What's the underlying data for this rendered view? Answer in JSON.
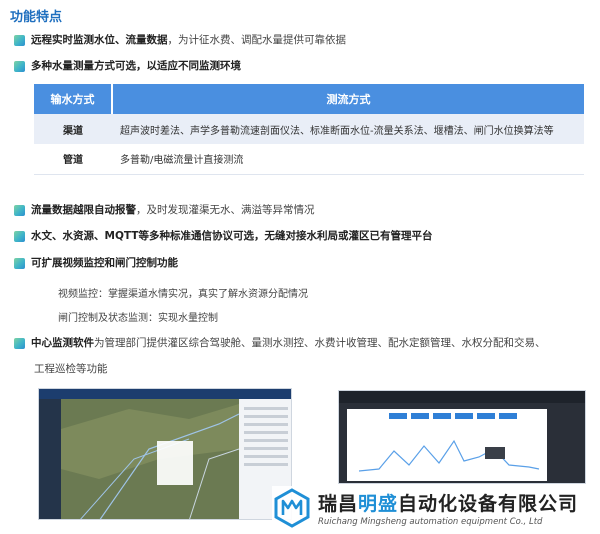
{
  "title": "功能特点",
  "bullets": [
    {
      "bold": "远程实时监测水位、流量数据",
      "normal": "，为计征水费、调配水量提供可靠依据"
    },
    {
      "bold": "多种水量测量方式可选，以适应不同监测环境",
      "normal": ""
    },
    {
      "bold": "流量数据越限自动报警",
      "normal": "，及时发现灌渠无水、满溢等异常情况"
    },
    {
      "bold": "水文、水资源、MQTT等多种标准通信协议可选，无缝对接水利局或灌区已有管理平台",
      "normal": ""
    },
    {
      "bold": "可扩展视频监控和闸门控制功能",
      "normal": ""
    },
    {
      "bold": "中心监测软件",
      "normal": "为管理部门提供灌区综合驾驶舱、量测水测控、水费计收管理、配水定额管理、水权分配和交易、"
    }
  ],
  "sub_items": [
    "视频监控：掌握渠道水情实况，真实了解水资源分配情况",
    "闸门控制及状态监测：实现水量控制"
  ],
  "continuation": "工程巡检等功能",
  "table": {
    "headers": [
      "输水方式",
      "测流方式"
    ],
    "rows": [
      [
        "渠道",
        "超声波时差法、声学多普勒流速剖面仪法、标准断面水位-流量关系法、堰槽法、闸门水位换算法等"
      ],
      [
        "管道",
        "多普勒/电磁流量计直接测流"
      ]
    ]
  },
  "watermark": {
    "cn_prefix": "瑞昌",
    "cn_highlight": "明盛",
    "cn_suffix": "自动化设备有限公司",
    "en": "Ruichang Mingsheng automation equipment Co., Ltd"
  },
  "colors": {
    "accent": "#1f6fbf",
    "table_header": "#4a8fe0",
    "logo": "#1f8fd6"
  }
}
